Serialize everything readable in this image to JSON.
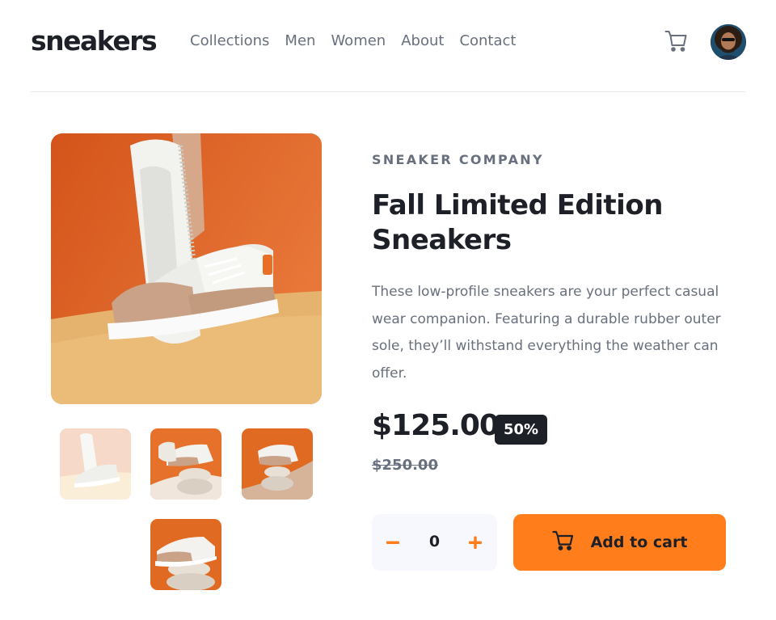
{
  "brand": {
    "logo": "sneakers"
  },
  "nav": {
    "items": [
      {
        "label": "Collections"
      },
      {
        "label": "Men"
      },
      {
        "label": "Women"
      },
      {
        "label": "About"
      },
      {
        "label": "Contact"
      }
    ]
  },
  "header": {
    "cart_icon": "cart-icon",
    "avatar": "user-avatar"
  },
  "product": {
    "company": "SNEAKER COMPANY",
    "title": "Fall Limited Edition Sneakers",
    "description": "These low-profile sneakers are your perfect casual wear companion. Featuring a durable rubber outer sole, they’ll withstand everything the weather can offer.",
    "price": "$125.00",
    "discount": "50%",
    "old_price": "$250.00"
  },
  "cart_controls": {
    "minus_icon": "minus-icon",
    "plus_icon": "plus-icon",
    "quantity": "0",
    "add_label": "Add to cart"
  },
  "colors": {
    "accent": "#ff7e1b",
    "dark": "#1d2026",
    "muted": "#69707d",
    "light_bg": "#f6f8fd"
  }
}
